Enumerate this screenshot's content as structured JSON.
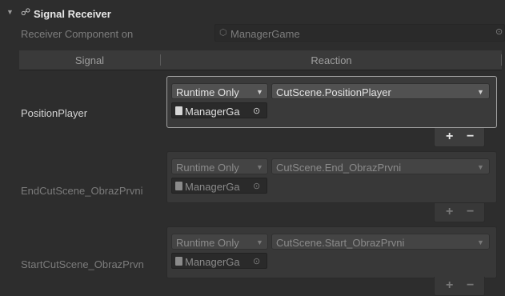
{
  "header": {
    "title": "Signal Receiver",
    "icon": "signal-icon",
    "fold_icon": "fold-triangle-icon"
  },
  "receiver": {
    "label": "Receiver Component on",
    "value": "ManagerGame",
    "object_icon": "gameobject-icon",
    "target_icon": "object-picker-icon"
  },
  "table": {
    "signal_header": "Signal",
    "reaction_header": "Reaction"
  },
  "rows": [
    {
      "signal": "PositionPlayer",
      "mode": "Runtime Only",
      "method": "CutScene.PositionPlayer",
      "object": "ManagerGa",
      "plus": "+",
      "minus": "−"
    },
    {
      "signal": "EndCutScene_ObrazPrvni",
      "mode": "Runtime Only",
      "method": "CutScene.End_ObrazPrvni",
      "object": "ManagerGa",
      "plus": "+",
      "minus": "−"
    },
    {
      "signal": "StartCutScene_ObrazPrvn",
      "mode": "Runtime Only",
      "method": "CutScene.Start_ObrazPrvni",
      "object": "ManagerGa",
      "plus": "+",
      "minus": "−"
    }
  ],
  "colors": {
    "background": "#2d2d2d",
    "active_border": "#a0a0a0",
    "dropdown": "#515151"
  }
}
